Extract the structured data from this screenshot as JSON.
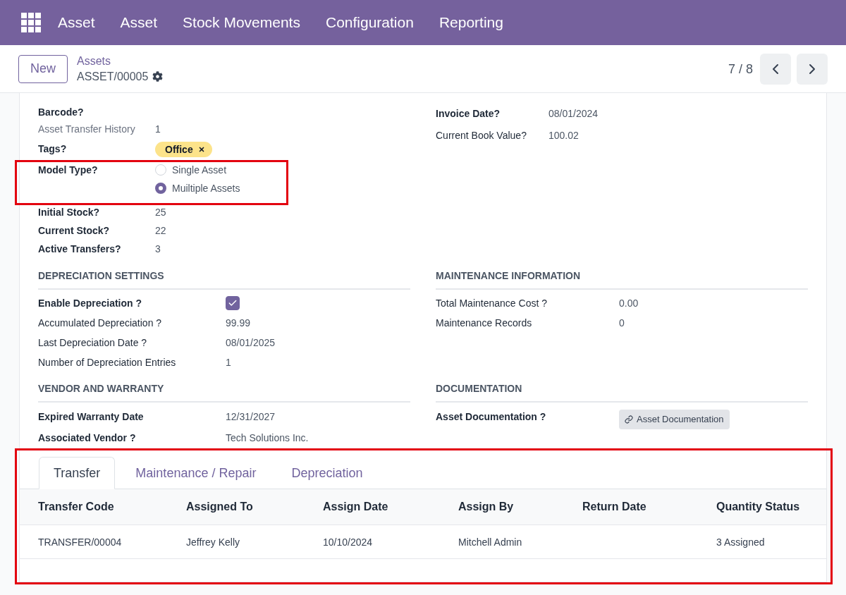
{
  "navbar": {
    "menu": [
      "Asset",
      "Asset",
      "Stock Movements",
      "Configuration",
      "Reporting"
    ]
  },
  "control_panel": {
    "new_button": "New",
    "breadcrumb": "Assets",
    "record": "ASSET/00005",
    "pager": "7 / 8"
  },
  "form": {
    "left_fields": [
      {
        "label": "Barcode?",
        "bold": true,
        "muted": false,
        "kind": "text"
      },
      {
        "label": "Asset Transfer History",
        "bold": false,
        "muted": true,
        "kind": "text",
        "value": "1"
      },
      {
        "label": "Tags?",
        "bold": true,
        "muted": false,
        "kind": "tags",
        "tags": [
          {
            "label": "Office",
            "color": "#fce38a"
          }
        ]
      },
      {
        "label": "Model Type?",
        "bold": true,
        "muted": false,
        "kind": "radio",
        "highlighted": true,
        "options": [
          {
            "label": "Single Asset",
            "selected": false
          },
          {
            "label": "Muiltiple Assets",
            "selected": true
          }
        ]
      },
      {
        "label": "Initial Stock?",
        "bold": true,
        "muted": false,
        "kind": "text",
        "value": "25"
      },
      {
        "label": "Current Stock?",
        "bold": true,
        "muted": false,
        "kind": "text",
        "value": "22"
      },
      {
        "label": "Active Transfers?",
        "bold": true,
        "muted": false,
        "kind": "text",
        "value": "3"
      }
    ],
    "right_fields": [
      {
        "label": "Invoice Date?",
        "bold": true,
        "kind": "text",
        "value": "08/01/2024"
      },
      {
        "label": "Current Book Value?",
        "bold": false,
        "kind": "text",
        "value": "100.02"
      }
    ],
    "sections": [
      {
        "title": "DEPRECIATION SETTINGS",
        "fields": [
          {
            "label": "Enable Depreciation ?",
            "bold": true,
            "kind": "checkbox",
            "checked": true
          },
          {
            "label": "Accumulated Depreciation ?",
            "bold": false,
            "kind": "text",
            "value": "99.99"
          },
          {
            "label": "Last Depreciation Date ?",
            "bold": false,
            "kind": "text",
            "value": "08/01/2025"
          },
          {
            "label": "Number of Depreciation Entries",
            "bold": false,
            "kind": "text",
            "value": "1"
          }
        ]
      },
      {
        "title": "MAINTENANCE INFORMATION",
        "fields": [
          {
            "label": "Total Maintenance Cost ?",
            "bold": false,
            "kind": "text",
            "value": "0.00"
          },
          {
            "label": "Maintenance Records",
            "bold": false,
            "kind": "text",
            "value": "0"
          }
        ]
      },
      {
        "title": "VENDOR AND WARRANTY",
        "fields": [
          {
            "label": "Expired Warranty Date",
            "bold": true,
            "kind": "text",
            "value": "12/31/2027"
          },
          {
            "label": "Associated Vendor ?",
            "bold": true,
            "kind": "text",
            "value": "Tech Solutions Inc."
          }
        ]
      },
      {
        "title": "DOCUMENTATION",
        "fields": [
          {
            "label": "Asset Documentation ?",
            "bold": true,
            "kind": "button",
            "button": "Asset Documentation"
          }
        ]
      }
    ]
  },
  "notebook": {
    "highlighted": true,
    "tabs": [
      {
        "label": "Transfer",
        "selected": true
      },
      {
        "label": "Maintenance / Repair",
        "selected": false
      },
      {
        "label": "Depreciation",
        "selected": false
      }
    ],
    "table": {
      "columns": [
        "Transfer Code",
        "Assigned To",
        "Assign Date",
        "Assign By",
        "Return Date",
        "Quantity Status"
      ],
      "rows": [
        {
          "cells": [
            "TRANSFER/00004",
            "Jeffrey Kelly",
            "10/10/2024",
            "Mitchell Admin",
            null,
            "3 Assigned"
          ]
        }
      ]
    }
  }
}
